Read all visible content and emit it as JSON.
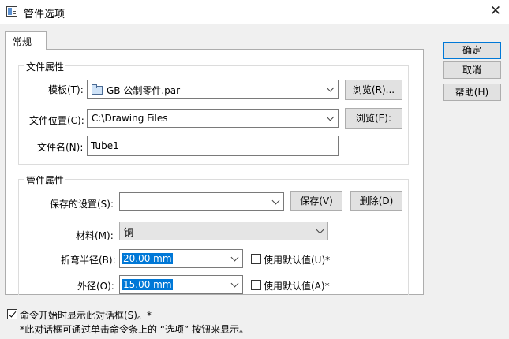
{
  "window": {
    "title": "管件选项",
    "close_glyph": "✕"
  },
  "tabs": [
    {
      "label": "常规"
    }
  ],
  "file_props": {
    "group_title": "文件属性",
    "template_label": "模板(T):",
    "template_value": "GB 公制零件.par",
    "browse1_label": "浏览(R)...",
    "location_label": "文件位置(C):",
    "location_value": "C:\\Drawing Files",
    "browse2_label": "浏览(E):",
    "filename_label": "文件名(N):",
    "filename_value": "Tube1"
  },
  "tube_props": {
    "group_title": "管件属性",
    "saved_settings_label": "保存的设置(S):",
    "saved_settings_value": "",
    "save_label": "保存(V)",
    "delete_label": "删除(D)",
    "material_label": "材料(M):",
    "material_value": "铜",
    "bend_radius_label": "折弯半径(B):",
    "bend_radius_value": "20.00 mm",
    "use_default1_label": "使用默认值(U)*",
    "outer_diameter_label": "外径(O):",
    "outer_diameter_value": "15.00 mm",
    "use_default2_label": "使用默认值(A)*"
  },
  "side_buttons": {
    "ok": "确定",
    "cancel": "取消",
    "help": "帮助(H)"
  },
  "footer": {
    "show_dialog_label": "命令开始时显示此对话框(S)。*",
    "show_dialog_checked": true,
    "note": "*此对话框可通过单击命令条上的 “选项” 按钮来显示。"
  },
  "icons": {
    "app": "dialog-icon",
    "template": "folder-icon"
  }
}
